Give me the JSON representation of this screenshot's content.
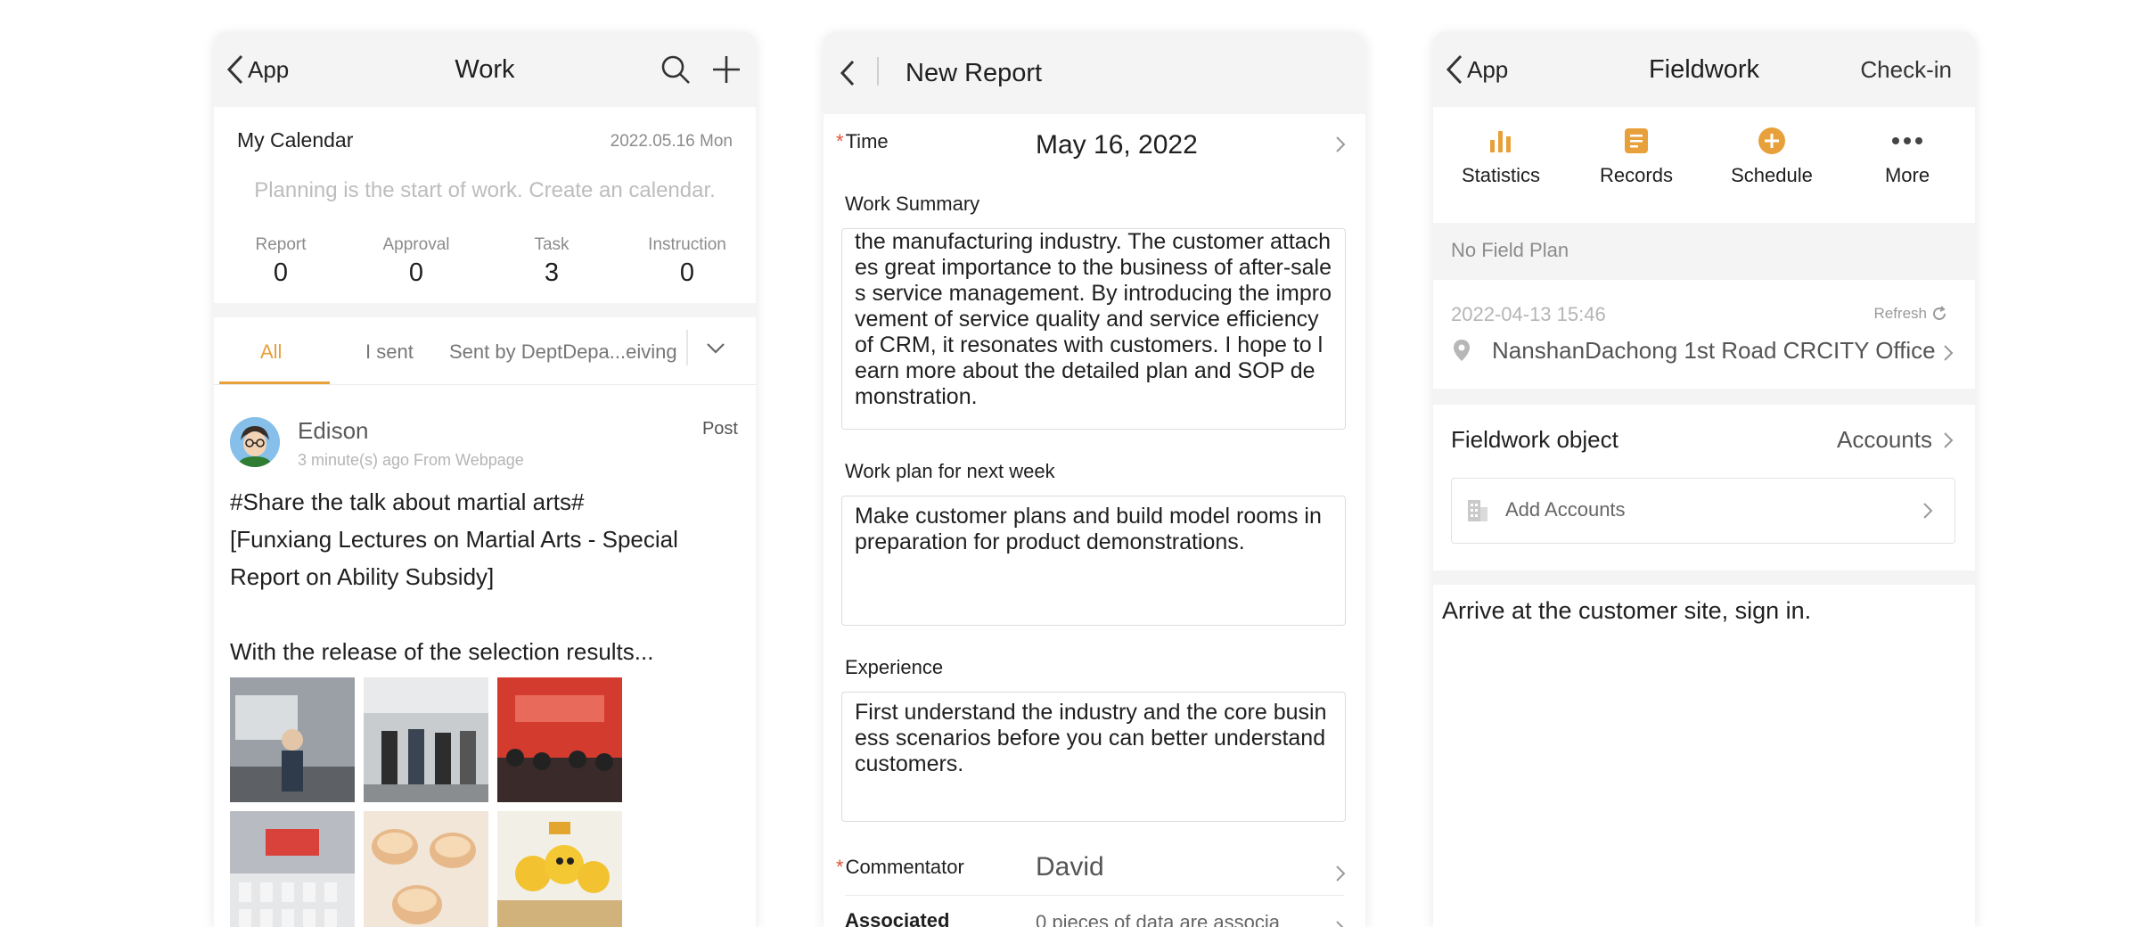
{
  "work": {
    "back_label": "App",
    "title": "Work",
    "calendar": {
      "title": "My Calendar",
      "date": "2022.05.16 Mon",
      "hint": "Planning is the start of work. Create an calendar."
    },
    "stats": [
      {
        "label": "Report",
        "value": "0"
      },
      {
        "label": "Approval",
        "value": "0"
      },
      {
        "label": "Task",
        "value": "3"
      },
      {
        "label": "Instruction",
        "value": "0"
      }
    ],
    "tabs": [
      "All",
      "I sent",
      "Sent by DeptDepa...eiving"
    ],
    "post": {
      "author": "Edison",
      "meta": "3 minute(s) ago From Webpage",
      "action": "Post",
      "lines": [
        "#Share the talk about martial arts#",
        "[Funxiang Lectures on Martial Arts - Special",
        "Report on Ability Subsidy]",
        "With the release of the selection results..."
      ]
    }
  },
  "report": {
    "title": "New Report",
    "time_label": "Time",
    "time_value": "May 16, 2022",
    "summary_label": "Work Summary",
    "summary_text": "the manufacturing industry. The customer attaches great importance to the business of after-sales service management. By introducing the improvement of service quality and service efficiency of CRM, it resonates with customers. I hope to learn more about the detailed plan and SOP demonstration.",
    "plan_label": "Work plan for next week",
    "plan_text": "Make customer plans and build model rooms in preparation for product demonstrations.",
    "experience_label": "Experience",
    "experience_text": "First understand the industry and the core business scenarios before you can better understand customers.",
    "commentator_label": "Commentator",
    "commentator_value": "David",
    "associated_label": "Associated",
    "associated_value": "0 pieces of data are associa"
  },
  "fieldwork": {
    "back_label": "App",
    "title": "Fieldwork",
    "action": "Check-in",
    "menu": [
      "Statistics",
      "Records",
      "Schedule",
      "More"
    ],
    "no_plan": "No Field Plan",
    "timestamp": "2022-04-13 15:46",
    "refresh": "Refresh",
    "location": "NanshanDachong 1st Road CRCITY Office...",
    "object_label": "Fieldwork object",
    "object_value": "Accounts",
    "add_accounts": "Add Accounts",
    "instruction": "Arrive at the customer site, sign in."
  },
  "colors": {
    "accent": "#e8a03a",
    "required": "#e0533b"
  }
}
